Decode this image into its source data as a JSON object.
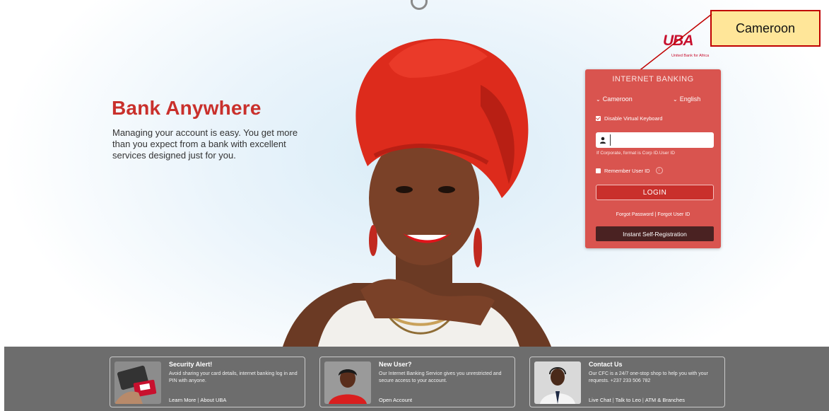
{
  "hero": {
    "title": "Bank Anywhere",
    "subtitle": "Managing your account is easy. You get more than you expect from a bank with excellent services designed just for you."
  },
  "brand": {
    "logo": "UBA",
    "tagline": "United Bank for Africa"
  },
  "annotation": {
    "callout": "Cameroon"
  },
  "login": {
    "title": "INTERNET BANKING",
    "country_select": "Cameroon",
    "language_select": "English",
    "virtual_keyboard_label": "Disable Virtual Keyboard",
    "virtual_keyboard_checked": true,
    "userid_value": "",
    "userid_hint": "If Corporate, format is Corp ID.User ID",
    "remember_label": "Remember User ID",
    "login_button": "LOGIN",
    "forgot_password": "Forgot Password",
    "forgot_userid": "Forgot User ID",
    "self_registration": "Instant Self-Registration"
  },
  "footer": {
    "cards": [
      {
        "title": "Security Alert!",
        "body": "Avoid sharing your card details, internet banking log in and PIN with anyone.",
        "links": [
          "Learn More",
          "About UBA"
        ]
      },
      {
        "title": "New User?",
        "body": "Our Internet Banking Service gives you unrestricted and secure access to your account.",
        "links": [
          "Open Account"
        ]
      },
      {
        "title": "Contact Us",
        "body": "Our CFC is a 24/7 one-stop shop to help you with your requests. +237 233 506 782",
        "links": [
          "Live Chat",
          "Talk to Leo",
          "ATM & Branches"
        ]
      }
    ]
  },
  "colors": {
    "brand_red": "#c8102e",
    "panel_red": "#d9544f",
    "footer_gray": "#6d6d6d",
    "callout_yellow": "#ffe699"
  }
}
